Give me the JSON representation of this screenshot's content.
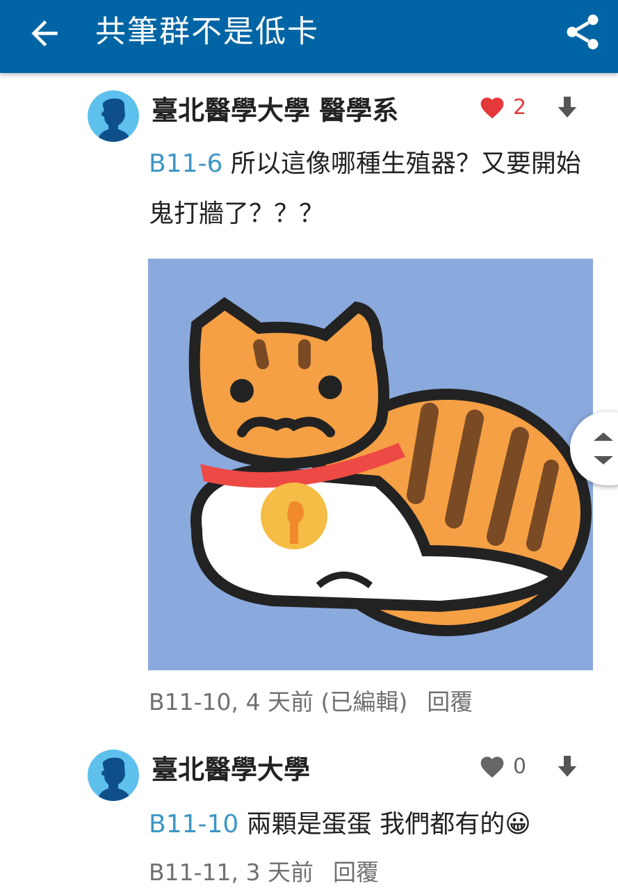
{
  "appbar": {
    "title": "共筆群不是低卡",
    "back_icon": "arrow-left-icon",
    "share_icon": "share-icon"
  },
  "comments": [
    {
      "author": "臺北醫學大學 醫學系",
      "likes": "2",
      "liked": true,
      "ref": "B11-6",
      "text": "所以這像哪種生殖器？又要開始鬼打牆了？？？",
      "image": "orange-tabby-cat-with-bell-sticker",
      "meta": "B11-10, 4 天前 (已編輯)",
      "reply_label": "回覆"
    },
    {
      "author": "臺北醫學大學",
      "likes": "0",
      "liked": false,
      "ref": "B11-10",
      "text": "兩顆是蛋蛋 我們都有的😀",
      "meta": "B11-11, 3 天前",
      "reply_label": "回覆"
    }
  ],
  "colors": {
    "appbar": "#0165a5",
    "link": "#3c97c6",
    "like_active": "#e5383b",
    "like_inactive": "#666666",
    "avatar_bg": "#5ec0ec"
  }
}
